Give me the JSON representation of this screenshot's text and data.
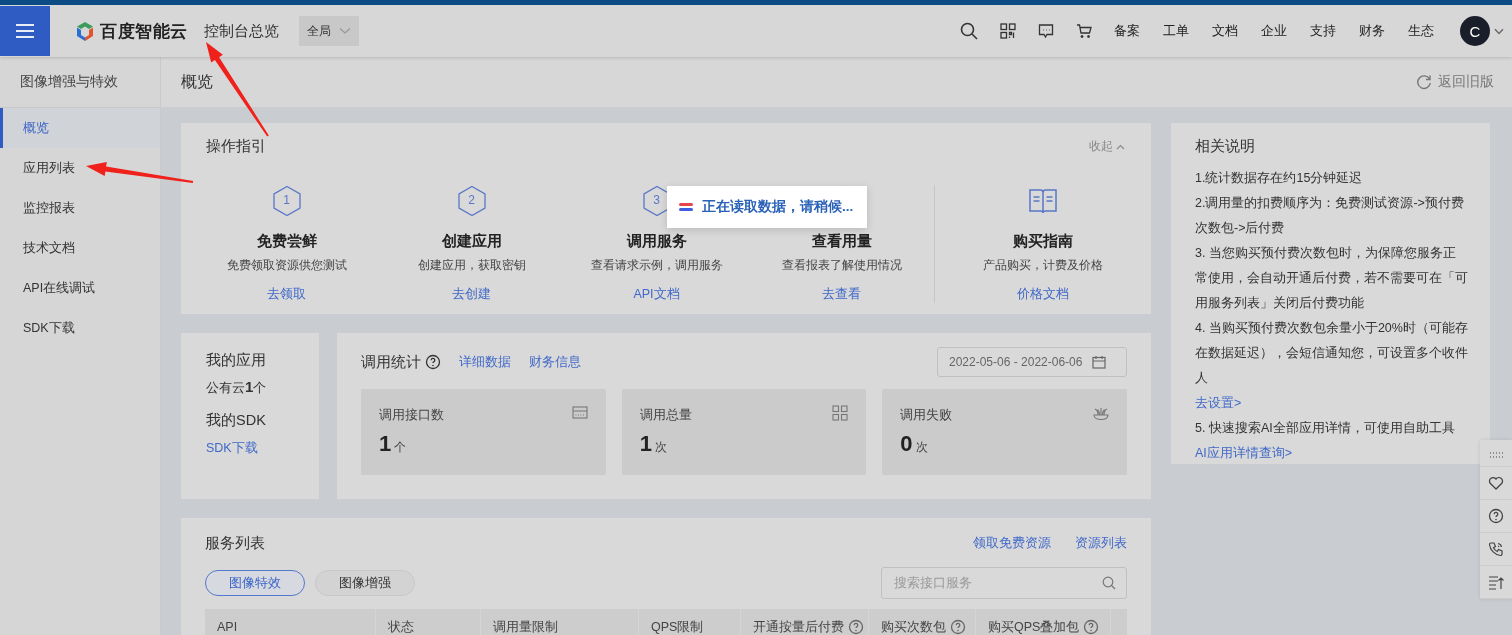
{
  "header": {
    "logo_text": "百度智能云",
    "title": "控制台总览",
    "region": "全局",
    "nav": [
      "备案",
      "工单",
      "文档",
      "企业",
      "支持",
      "财务",
      "生态"
    ],
    "avatar": "C"
  },
  "sidebar": {
    "title": "图像增强与特效",
    "items": [
      {
        "label": "概览",
        "selected": true
      },
      {
        "label": "应用列表",
        "selected": false
      },
      {
        "label": "监控报表",
        "selected": false
      },
      {
        "label": "技术文档",
        "selected": false
      },
      {
        "label": "API在线调试",
        "selected": false
      },
      {
        "label": "SDK下载",
        "selected": false
      }
    ]
  },
  "page": {
    "title": "概览",
    "back_link": "返回旧版"
  },
  "guide": {
    "title": "操作指引",
    "collapse": "收起",
    "steps": [
      {
        "kind": "step",
        "number": "1",
        "title": "免费尝鲜",
        "description": "免费领取资源供您测试",
        "link": "去领取"
      },
      {
        "kind": "step",
        "number": "2",
        "title": "创建应用",
        "description": "创建应用，获取密钥",
        "link": "去创建"
      },
      {
        "kind": "step",
        "number": "3",
        "title": "调用服务",
        "description": "查看请求示例，调用服务",
        "link": "API文档"
      },
      {
        "kind": "step",
        "title": "查看用量",
        "description": "查看报表了解使用情况",
        "link": "去查看"
      },
      {
        "kind": "purchase",
        "title": "购买指南",
        "description": "产品购买，计费及价格",
        "link": "价格文档"
      }
    ]
  },
  "my_apps": {
    "title": "我的应用",
    "count": "公有云**1**个",
    "sdk_title": "我的SDK",
    "sdk_link": "SDK下载"
  },
  "stats": {
    "title": "调用统计",
    "links": [
      "详细数据",
      "财务信息"
    ],
    "date_range": "2022-05-06 - 2022-06-06",
    "tiles": [
      {
        "label": "调用接口数",
        "value": "1",
        "unit": "个"
      },
      {
        "label": "调用总量",
        "value": "1",
        "unit": "次"
      },
      {
        "label": "调用失败",
        "value": "0",
        "unit": "次"
      }
    ]
  },
  "notes": {
    "title": "相关说明",
    "items": [
      {
        "text": "1.统计数据存在约15分钟延迟"
      },
      {
        "text": "2.调用量的扣费顺序为：免费测试资源->预付费次数包->后付费"
      },
      {
        "text": "3. 当您购买预付费次数包时，为保障您服务正常使用，会自动开通后付费，若不需要可在「可用服务列表」关闭后付费功能"
      },
      {
        "text": "4. 当购买预付费次数包余量小于20%时（可能存在数据延迟），会短信通知您，可设置多个收件人"
      },
      {
        "link": "去设置>"
      },
      {
        "text": "5. 快速搜索AI全部应用详情，可使用自助工具",
        "link": "AI应用详情查询>"
      }
    ]
  },
  "services": {
    "title": "服务列表",
    "links": [
      "领取免费资源",
      "资源列表"
    ],
    "tabs": [
      {
        "label": "图像特效",
        "selected": true
      },
      {
        "label": "图像增强",
        "selected": false
      }
    ],
    "search": {
      "placeholder": "搜索接口服务"
    },
    "columns": [
      {
        "label": "API",
        "help": false
      },
      {
        "label": "状态",
        "help": false
      },
      {
        "label": "调用量限制",
        "help": false
      },
      {
        "label": "QPS限制",
        "help": false
      },
      {
        "label": "开通按量后付费",
        "help": true
      },
      {
        "label": "购买次数包",
        "help": true
      },
      {
        "label": "购买QPS叠加包",
        "help": true
      }
    ]
  },
  "loading": {
    "message": "正在读取数据，请稍候..."
  }
}
